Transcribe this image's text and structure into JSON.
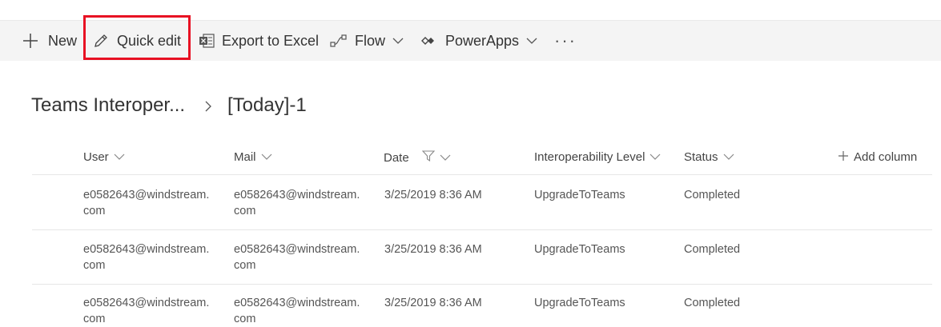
{
  "toolbar": {
    "new_label": "New",
    "quick_edit_label": "Quick edit",
    "export_label": "Export to Excel",
    "flow_label": "Flow",
    "powerapps_label": "PowerApps",
    "more_label": "···"
  },
  "breadcrumb": {
    "list_name": "Teams Interoper...",
    "view_name": "[Today]-1"
  },
  "columns": {
    "user": "User",
    "mail": "Mail",
    "date": "Date",
    "interop": "Interoperability Level",
    "status": "Status",
    "add_column": "Add column"
  },
  "rows": [
    {
      "user_1": "e0582643@windstream.",
      "user_2": "com",
      "mail_1": "e0582643@windstream.",
      "mail_2": "com",
      "date": "3/25/2019 8:36 AM",
      "interop": "UpgradeToTeams",
      "status": "Completed"
    },
    {
      "user_1": "e0582643@windstream.",
      "user_2": "com",
      "mail_1": "e0582643@windstream.",
      "mail_2": "com",
      "date": "3/25/2019 8:36 AM",
      "interop": "UpgradeToTeams",
      "status": "Completed"
    },
    {
      "user_1": "e0582643@windstream.",
      "user_2": "com",
      "mail_1": "e0582643@windstream.",
      "mail_2": "com",
      "date": "3/25/2019 8:36 AM",
      "interop": "UpgradeToTeams",
      "status": "Completed"
    }
  ],
  "colors": {
    "highlight": "#e81123",
    "toolbar_bg": "#f4f4f4"
  }
}
